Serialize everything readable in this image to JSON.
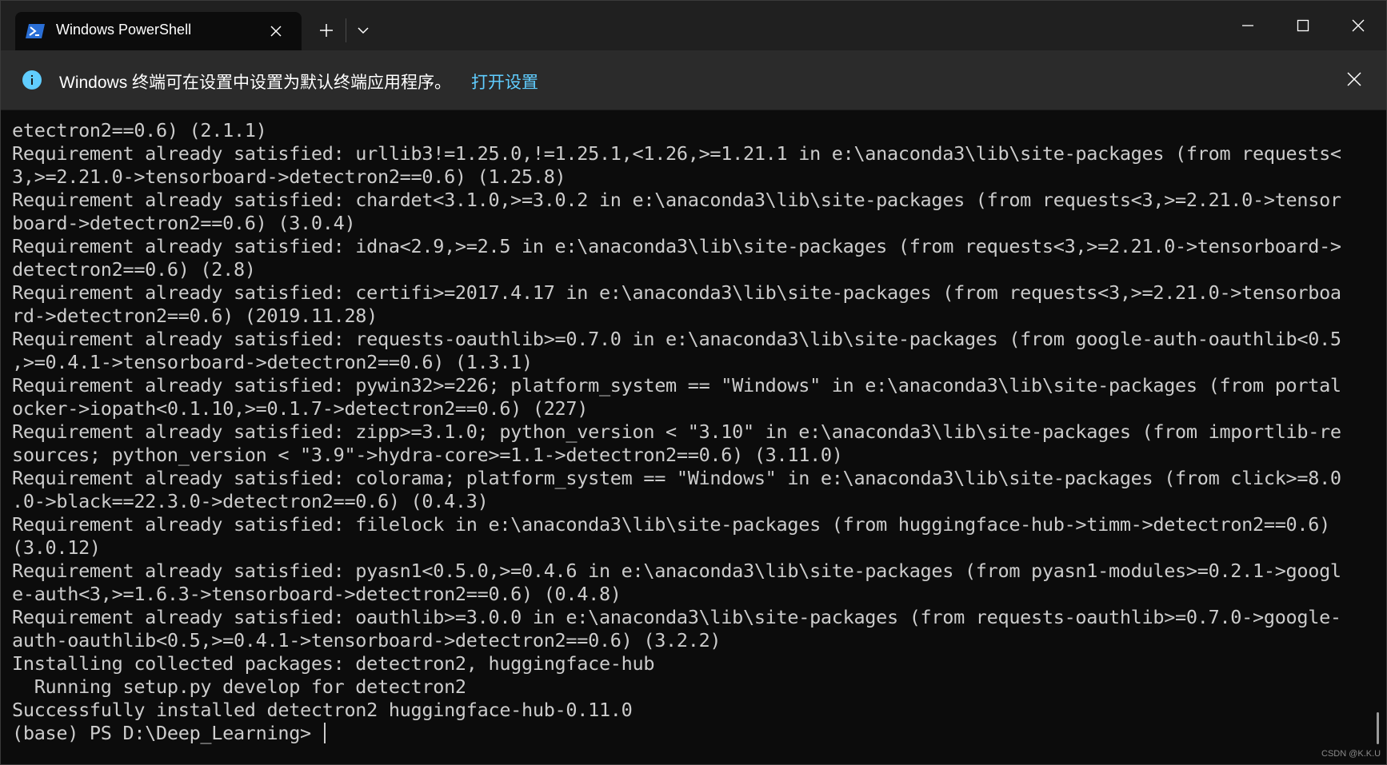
{
  "tab": {
    "title": "Windows PowerShell",
    "icon": "powershell-icon"
  },
  "titlebar": {
    "new_tab_icon": "plus-icon",
    "dropdown_icon": "chevron-down-icon",
    "minimize_icon": "minimize-icon",
    "maximize_icon": "maximize-icon",
    "close_icon": "close-icon"
  },
  "infobar": {
    "message": "Windows 终端可在设置中设置为默认终端应用程序。",
    "link": "打开设置",
    "icon": "info-icon"
  },
  "terminal": {
    "lines": [
      "etectron2==0.6) (2.1.1)",
      "Requirement already satisfied: urllib3!=1.25.0,!=1.25.1,<1.26,>=1.21.1 in e:\\anaconda3\\lib\\site-packages (from requests<",
      "3,>=2.21.0->tensorboard->detectron2==0.6) (1.25.8)",
      "Requirement already satisfied: chardet<3.1.0,>=3.0.2 in e:\\anaconda3\\lib\\site-packages (from requests<3,>=2.21.0->tensor",
      "board->detectron2==0.6) (3.0.4)",
      "Requirement already satisfied: idna<2.9,>=2.5 in e:\\anaconda3\\lib\\site-packages (from requests<3,>=2.21.0->tensorboard->",
      "detectron2==0.6) (2.8)",
      "Requirement already satisfied: certifi>=2017.4.17 in e:\\anaconda3\\lib\\site-packages (from requests<3,>=2.21.0->tensorboa",
      "rd->detectron2==0.6) (2019.11.28)",
      "Requirement already satisfied: requests-oauthlib>=0.7.0 in e:\\anaconda3\\lib\\site-packages (from google-auth-oauthlib<0.5",
      ",>=0.4.1->tensorboard->detectron2==0.6) (1.3.1)",
      "Requirement already satisfied: pywin32>=226; platform_system == \"Windows\" in e:\\anaconda3\\lib\\site-packages (from portal",
      "ocker->iopath<0.1.10,>=0.1.7->detectron2==0.6) (227)",
      "Requirement already satisfied: zipp>=3.1.0; python_version < \"3.10\" in e:\\anaconda3\\lib\\site-packages (from importlib-re",
      "sources; python_version < \"3.9\"->hydra-core>=1.1->detectron2==0.6) (3.11.0)",
      "Requirement already satisfied: colorama; platform_system == \"Windows\" in e:\\anaconda3\\lib\\site-packages (from click>=8.0",
      ".0->black==22.3.0->detectron2==0.6) (0.4.3)",
      "Requirement already satisfied: filelock in e:\\anaconda3\\lib\\site-packages (from huggingface-hub->timm->detectron2==0.6)",
      "(3.0.12)",
      "Requirement already satisfied: pyasn1<0.5.0,>=0.4.6 in e:\\anaconda3\\lib\\site-packages (from pyasn1-modules>=0.2.1->googl",
      "e-auth<3,>=1.6.3->tensorboard->detectron2==0.6) (0.4.8)",
      "Requirement already satisfied: oauthlib>=3.0.0 in e:\\anaconda3\\lib\\site-packages (from requests-oauthlib>=0.7.0->google-",
      "auth-oauthlib<0.5,>=0.4.1->tensorboard->detectron2==0.6) (3.2.2)",
      "Installing collected packages: detectron2, huggingface-hub",
      "  Running setup.py develop for detectron2",
      "Successfully installed detectron2 huggingface-hub-0.11.0"
    ],
    "prompt": "(base) PS D:\\Deep_Learning> "
  },
  "watermark": "CSDN @K.K.U",
  "colors": {
    "terminal_bg": "#0c0c0c",
    "terminal_fg": "#cccccc",
    "titlebar_bg": "#202020",
    "infobar_bg": "#2b2b2b",
    "link": "#60cdff",
    "accent": "#2a6fd6"
  }
}
